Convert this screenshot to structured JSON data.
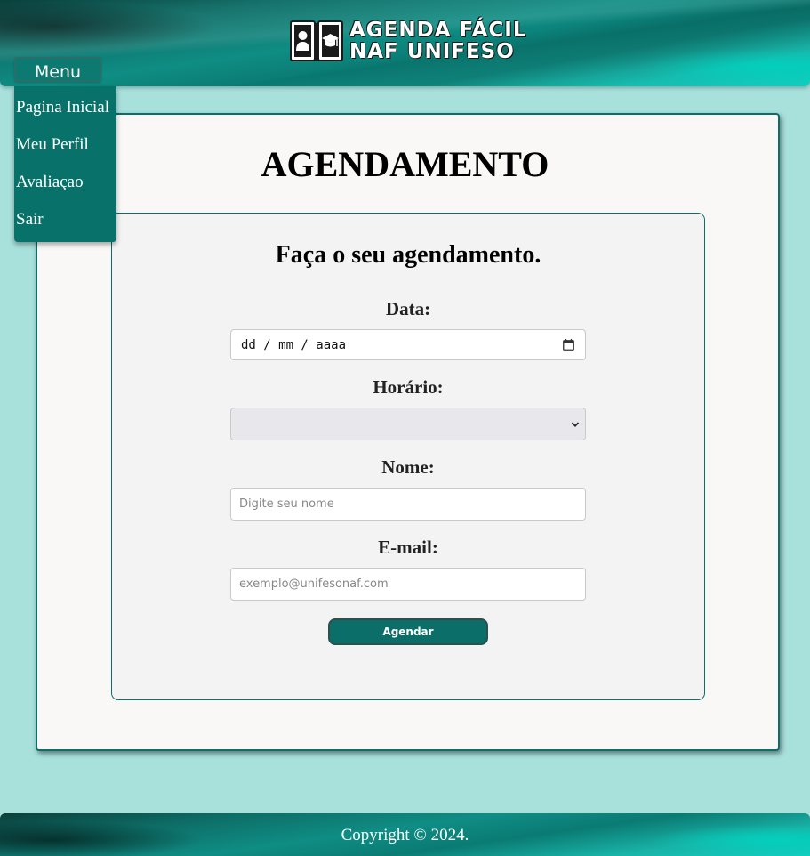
{
  "header": {
    "logo_line1": "AGENDA FÁCIL",
    "logo_line2": "NAF UNIFESO",
    "logo_icon": "book-with-user-and-graduation-cap-icon"
  },
  "menu": {
    "label": "Menu",
    "items": [
      {
        "label": "Pagina Inicial"
      },
      {
        "label": "Meu Perfil"
      },
      {
        "label": "Avaliaçao"
      },
      {
        "label": "Sair"
      }
    ]
  },
  "main": {
    "title": "AGENDAMENTO",
    "form": {
      "title": "Faça o seu agendamento.",
      "date": {
        "label": "Data:",
        "value": "dd / mm / aaaa",
        "icon": "calendar-icon"
      },
      "time": {
        "label": "Horário:",
        "selected": "",
        "icon": "chevron-down-icon"
      },
      "name": {
        "label": "Nome:",
        "placeholder": "Digite seu nome",
        "value": ""
      },
      "email": {
        "label": "E-mail:",
        "placeholder": "exemplo@unifesonaf.com",
        "value": ""
      },
      "submit_label": "Agendar"
    }
  },
  "footer": {
    "text": "Copyright © 2024."
  },
  "colors": {
    "page_background": "#a8e0dc",
    "brand_teal": "#0b6e69",
    "menu_background": "#08726a",
    "card_background": "#faf8f6",
    "form_background": "#f3f3f3"
  }
}
